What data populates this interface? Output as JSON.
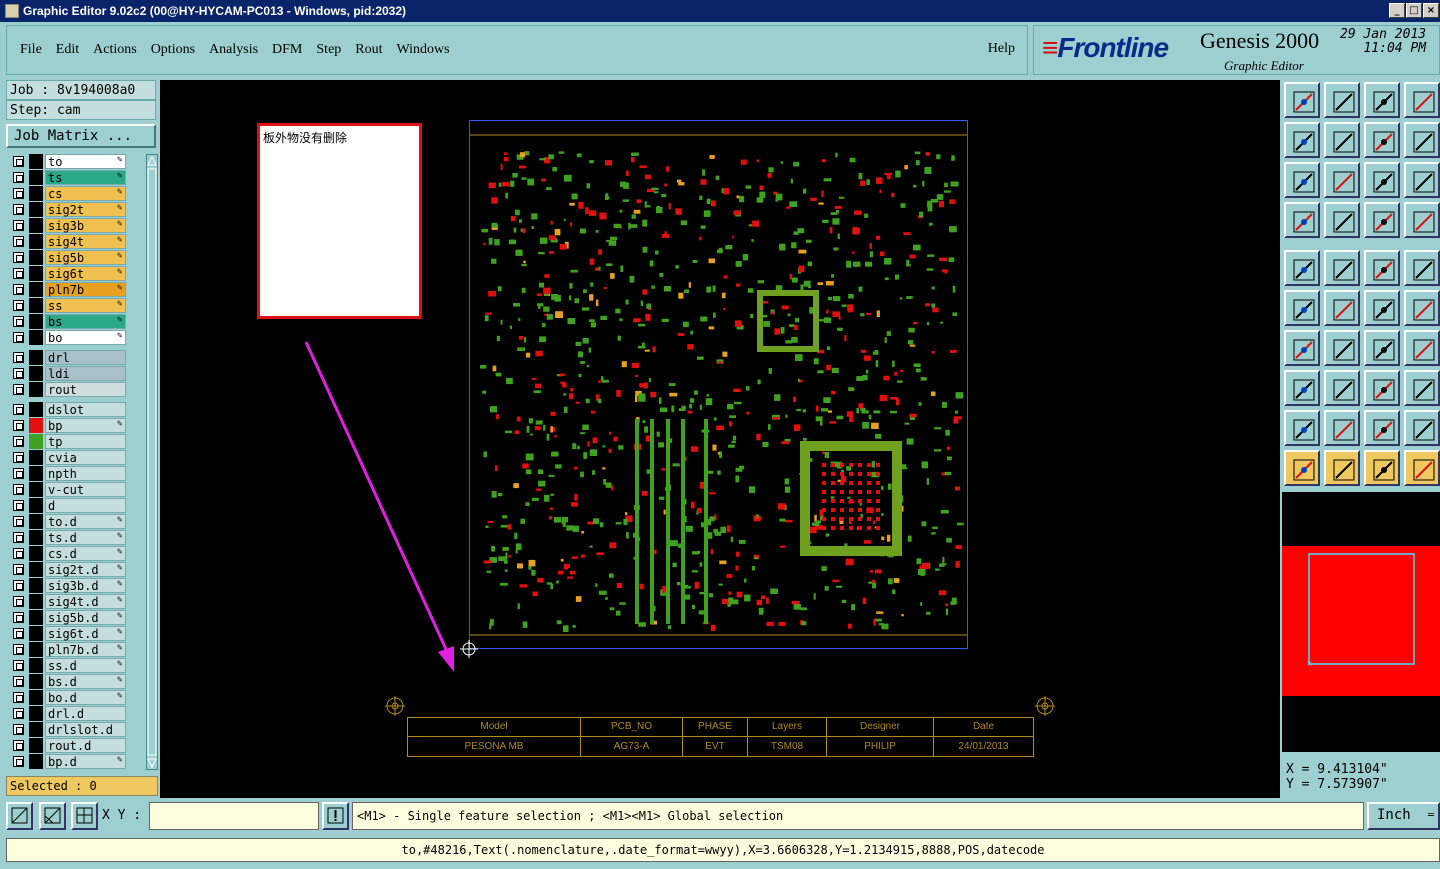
{
  "window": {
    "title": "Graphic Editor 9.02c2 (00@HY-HYCAM-PC013 - Windows, pid:2032)"
  },
  "menu": {
    "items": [
      "File",
      "Edit",
      "Actions",
      "Options",
      "Analysis",
      "DFM",
      "Step",
      "Rout",
      "Windows"
    ],
    "help": "Help"
  },
  "brand": {
    "logo": "Frontline",
    "product": "Genesis 2000",
    "subtitle": "Graphic Editor",
    "date": "29 Jan 2013",
    "time": "11:04 PM"
  },
  "job": {
    "job": "Job : 8v194008a0",
    "step": "Step: cam",
    "matrix_button": "Job Matrix ..."
  },
  "layers": [
    {
      "name": "to",
      "color": "#ffffff",
      "swatch": "#000000",
      "pen": true
    },
    {
      "name": "ts",
      "color": "#2aa888",
      "swatch": "#000000",
      "pen": true
    },
    {
      "name": "cs",
      "color": "#f0c050",
      "swatch": "#000000",
      "pen": true
    },
    {
      "name": "sig2t",
      "color": "#f0c050",
      "swatch": "#000000",
      "pen": true
    },
    {
      "name": "sig3b",
      "color": "#f0c050",
      "swatch": "#000000",
      "pen": true
    },
    {
      "name": "sig4t",
      "color": "#f0c050",
      "swatch": "#000000",
      "pen": true
    },
    {
      "name": "sig5b",
      "color": "#f0c050",
      "swatch": "#000000",
      "pen": true
    },
    {
      "name": "sig6t",
      "color": "#f0c050",
      "swatch": "#000000",
      "pen": true
    },
    {
      "name": "pln7b",
      "color": "#e8a020",
      "swatch": "#000000",
      "pen": true
    },
    {
      "name": "ss",
      "color": "#f0c050",
      "swatch": "#000000",
      "pen": true
    },
    {
      "name": "bs",
      "color": "#2aa888",
      "swatch": "#000000",
      "pen": true
    },
    {
      "name": "bo",
      "color": "#ffffff",
      "swatch": "#000000",
      "pen": true
    },
    {
      "name": "drl",
      "color": "#a8c0c8",
      "swatch": "#000000",
      "pen": false
    },
    {
      "name": "ldi",
      "color": "#a8c0c8",
      "swatch": "#000000",
      "pen": false
    },
    {
      "name": "rout",
      "color": "#d0dede",
      "swatch": "#000000",
      "pen": false
    },
    {
      "name": "dslot",
      "color": "#c3dedd",
      "swatch": "#000000",
      "pen": false
    },
    {
      "name": "bp",
      "color": "#c3dedd",
      "swatch": "#e01010",
      "pen": true
    },
    {
      "name": "tp",
      "color": "#c3dedd",
      "swatch": "#40a020",
      "pen": false
    },
    {
      "name": "cvia",
      "color": "#c3dedd",
      "swatch": "#000000",
      "pen": false
    },
    {
      "name": "npth",
      "color": "#c3dedd",
      "swatch": "#000000",
      "pen": false
    },
    {
      "name": "v-cut",
      "color": "#c3dedd",
      "swatch": "#000000",
      "pen": false
    },
    {
      "name": "d",
      "color": "#c3dedd",
      "swatch": "#000000",
      "pen": false
    },
    {
      "name": "to.d",
      "color": "#c3dedd",
      "swatch": "#000000",
      "pen": true
    },
    {
      "name": "ts.d",
      "color": "#c3dedd",
      "swatch": "#000000",
      "pen": true
    },
    {
      "name": "cs.d",
      "color": "#c3dedd",
      "swatch": "#000000",
      "pen": true
    },
    {
      "name": "sig2t.d",
      "color": "#c3dedd",
      "swatch": "#000000",
      "pen": true
    },
    {
      "name": "sig3b.d",
      "color": "#c3dedd",
      "swatch": "#000000",
      "pen": true
    },
    {
      "name": "sig4t.d",
      "color": "#c3dedd",
      "swatch": "#000000",
      "pen": true
    },
    {
      "name": "sig5b.d",
      "color": "#c3dedd",
      "swatch": "#000000",
      "pen": true
    },
    {
      "name": "sig6t.d",
      "color": "#c3dedd",
      "swatch": "#000000",
      "pen": true
    },
    {
      "name": "pln7b.d",
      "color": "#c3dedd",
      "swatch": "#000000",
      "pen": true
    },
    {
      "name": "ss.d",
      "color": "#c3dedd",
      "swatch": "#000000",
      "pen": true
    },
    {
      "name": "bs.d",
      "color": "#c3dedd",
      "swatch": "#000000",
      "pen": true
    },
    {
      "name": "bo.d",
      "color": "#c3dedd",
      "swatch": "#000000",
      "pen": true
    },
    {
      "name": "drl.d",
      "color": "#c3dedd",
      "swatch": "#000000",
      "pen": false
    },
    {
      "name": "drlslot.d",
      "color": "#c3dedd",
      "swatch": "#000000",
      "pen": false
    },
    {
      "name": "rout.d",
      "color": "#c3dedd",
      "swatch": "#000000",
      "pen": false
    },
    {
      "name": "bp.d",
      "color": "#c3dedd",
      "swatch": "#000000",
      "pen": true
    }
  ],
  "selected": "Selected : 0",
  "canvas": {
    "note": "板外物没有删除",
    "title_block": {
      "headers": [
        "Model",
        "PCB_NO",
        "PHASE",
        "Layers",
        "Designer",
        "Date"
      ],
      "values": [
        "PESONA MB",
        "AG73-A",
        "EVT",
        "TSM08",
        "PHILIP",
        "24/01/2013"
      ]
    }
  },
  "coords": {
    "x": "X = 9.413104\"",
    "y": "Y = 7.573907\""
  },
  "bottom": {
    "xy_label": "X Y :",
    "xy_value": "",
    "message": "<M1> - Single feature selection ; <M1><M1> Global selection",
    "units": "Inch"
  },
  "status": "to,#48216,Text(.nomenclature,.date_format=wwyy),X=3.6606328,Y=1.2134915,8888,POS,datecode",
  "colors": {
    "accent_bg": "#9ecfd0",
    "title_bar": "#0a246a",
    "canvas": "#000000",
    "highlight": "#f0c860",
    "note_border": "#e01010",
    "arrow": "#e020e0"
  }
}
